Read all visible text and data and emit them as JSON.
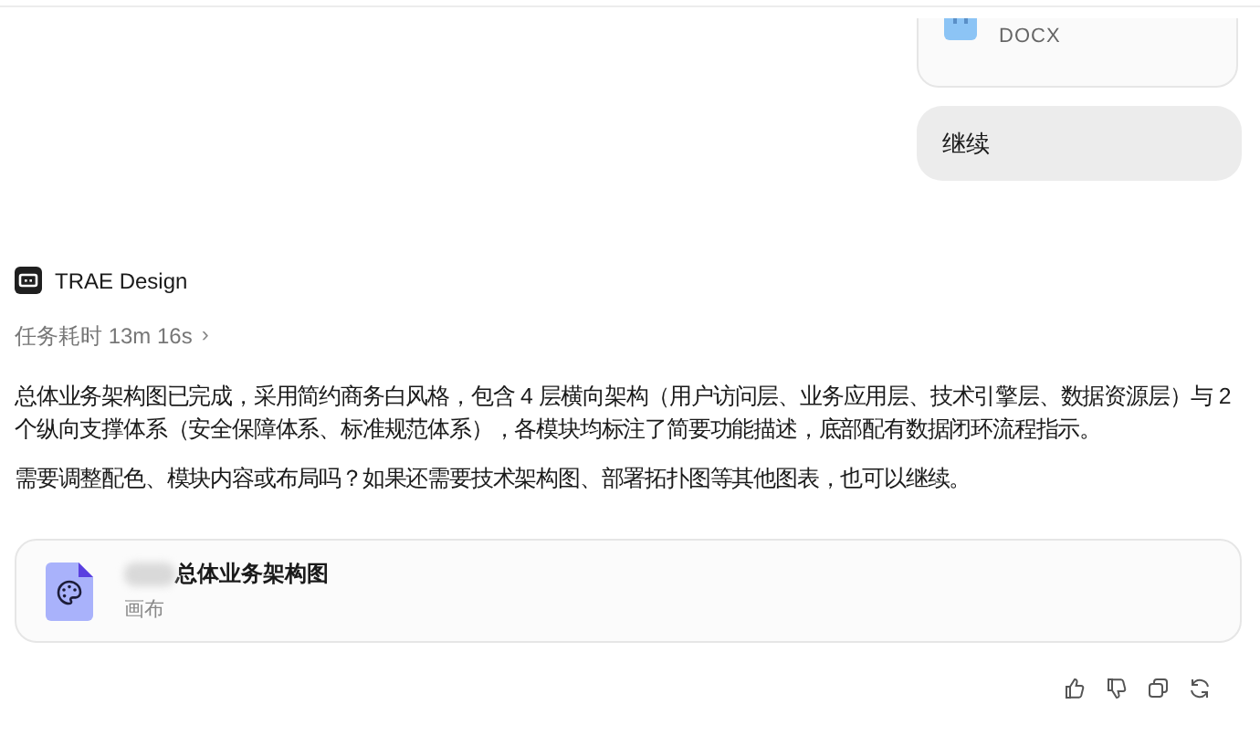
{
  "attachment": {
    "type": "DOCX"
  },
  "user_message": {
    "text": "继续"
  },
  "agent": {
    "name": "TRAE Design",
    "duration": "任务耗时 13m 16s",
    "duration_chevron": "›"
  },
  "reply": {
    "paragraphs": [
      "总体业务架构图已完成，采用简约商务白风格，包含 4 层横向架构（用户访问层、业务应用层、技术引擎层、数据资源层）与 2 个纵向支撑体系（安全保障体系、标准规范体系），各模块均标注了简要功能描述，底部配有数据闭环流程指示。",
      "需要调整配色、模块内容或布局吗？如果还需要技术架构图、部署拓扑图等其他图表，也可以继续。"
    ]
  },
  "file_card": {
    "title": "总体业务架构图",
    "type": "画布",
    "redacted": true
  },
  "actions": [
    {
      "kind": "like"
    },
    {
      "kind": "dislike"
    },
    {
      "kind": "copy"
    },
    {
      "kind": "retry"
    }
  ]
}
